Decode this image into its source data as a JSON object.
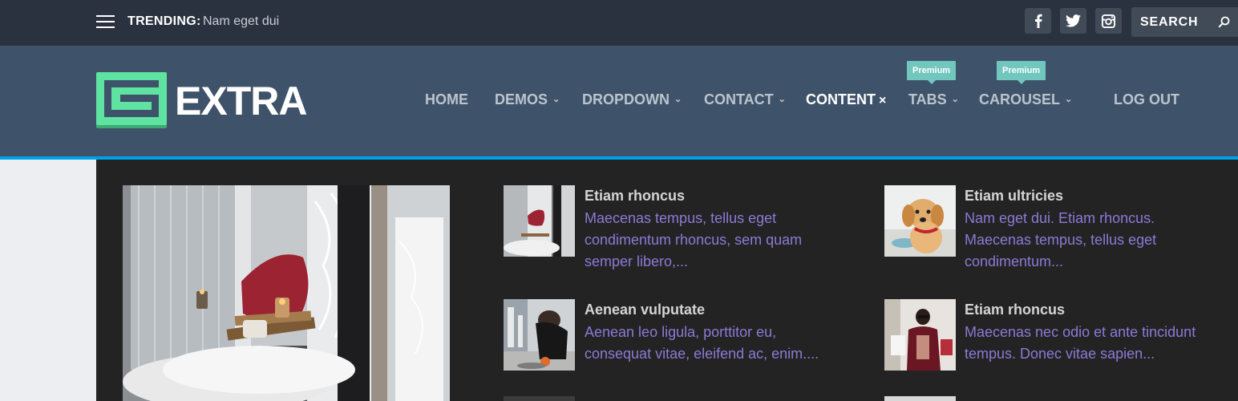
{
  "topbar": {
    "trending_label": "TRENDING:",
    "trending_text": "Nam eget dui",
    "search_placeholder": "SEARCH",
    "social": [
      "facebook-icon",
      "twitter-icon",
      "instagram-icon"
    ]
  },
  "header": {
    "logo_text": "EXTRA",
    "nav": [
      {
        "label": "HOME",
        "dropdown": false
      },
      {
        "label": "DEMOS",
        "dropdown": true
      },
      {
        "label": "DROPDOWN",
        "dropdown": true
      },
      {
        "label": "CONTACT",
        "dropdown": true
      },
      {
        "label": "CONTENT",
        "dropdown": false,
        "active": true,
        "close": "×"
      },
      {
        "label": "TABS",
        "dropdown": true,
        "badge": "Premium"
      },
      {
        "label": "CAROUSEL",
        "dropdown": true,
        "badge": "Premium"
      },
      {
        "label": "LOG OUT",
        "dropdown": false
      }
    ],
    "chevron": "⌄"
  },
  "mega_menu": {
    "posts_col1": [
      {
        "title": "Etiam rhoncus",
        "excerpt": "Maecenas tempus, tellus eget condimentum rhoncus, sem quam semper libero,..."
      },
      {
        "title": "Aenean vulputate",
        "excerpt": "Aenean leo ligula, porttitor eu, consequat vitae, eleifend ac, enim...."
      }
    ],
    "posts_col2": [
      {
        "title": "Etiam ultricies",
        "excerpt": "Nam eget dui. Etiam rhoncus. Maecenas tempus, tellus eget condimentum..."
      },
      {
        "title": "Etiam rhoncus",
        "excerpt": "Maecenas nec odio et ante tincidunt tempus. Donec vitae sapien..."
      }
    ]
  },
  "colors": {
    "topbar": "#29323e",
    "header": "#3e5369",
    "accent_border": "#00a2f0",
    "logo_green": "#5ee3a1",
    "badge": "#71c7bd",
    "panel": "#232323",
    "excerpt": "#8c7ad6"
  }
}
